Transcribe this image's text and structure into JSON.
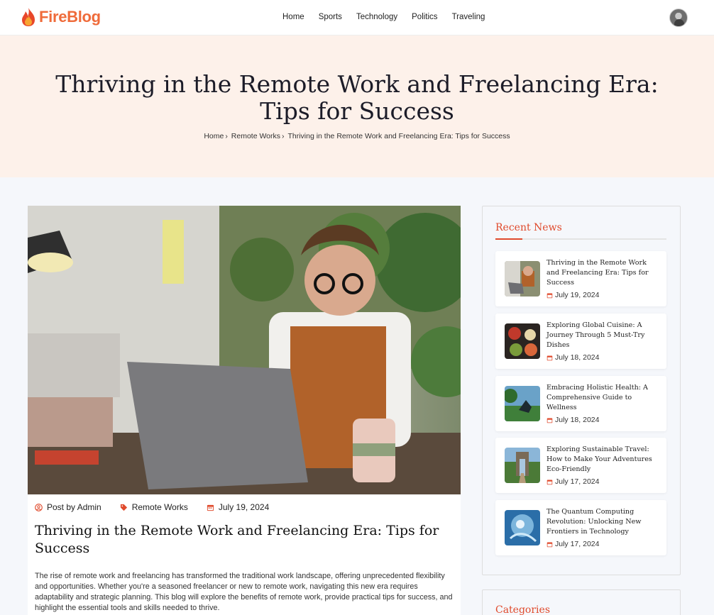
{
  "brand": {
    "name": "FireBlog",
    "color": "#ef6b3a"
  },
  "nav": [
    "Home",
    "Sports",
    "Technology",
    "Politics",
    "Traveling"
  ],
  "hero": {
    "title": "Thriving in the Remote Work and Freelancing Era: Tips for Success",
    "breadcrumb": [
      "Home",
      "Remote Works",
      "Thriving in the Remote Work and Freelancing Era: Tips for Success"
    ]
  },
  "article": {
    "author": "Post by Admin",
    "category": "Remote Works",
    "date": "July 19, 2024",
    "title": "Thriving in the Remote Work and Freelancing Era: Tips for Success",
    "body": "The rise of remote work and freelancing has transformed the traditional work landscape, offering unprecedented flexibility and opportunities. Whether you're a seasoned freelancer or new to remote work, navigating this new era requires adaptability and strategic planning. This blog will explore the benefits of remote work, provide practical tips for success, and highlight the essential tools and skills needed to thrive."
  },
  "sidebar": {
    "recent_heading": "Recent News",
    "categories_heading": "Categories",
    "accent": "#e04a2c",
    "news": [
      {
        "title": "Thriving in the Remote Work and Freelancing Era: Tips for Success",
        "date": "July 19, 2024"
      },
      {
        "title": "Exploring Global Cuisine: A Journey Through 5 Must-Try Dishes",
        "date": "July 18, 2024"
      },
      {
        "title": "Embracing Holistic Health: A Comprehensive Guide to Wellness",
        "date": "July 18, 2024"
      },
      {
        "title": "Exploring Sustainable Travel: How to Make Your Adventures Eco-Friendly",
        "date": "July 17, 2024"
      },
      {
        "title": "The Quantum Computing Revolution: Unlocking New Frontiers in Technology",
        "date": "July 17, 2024"
      }
    ]
  }
}
